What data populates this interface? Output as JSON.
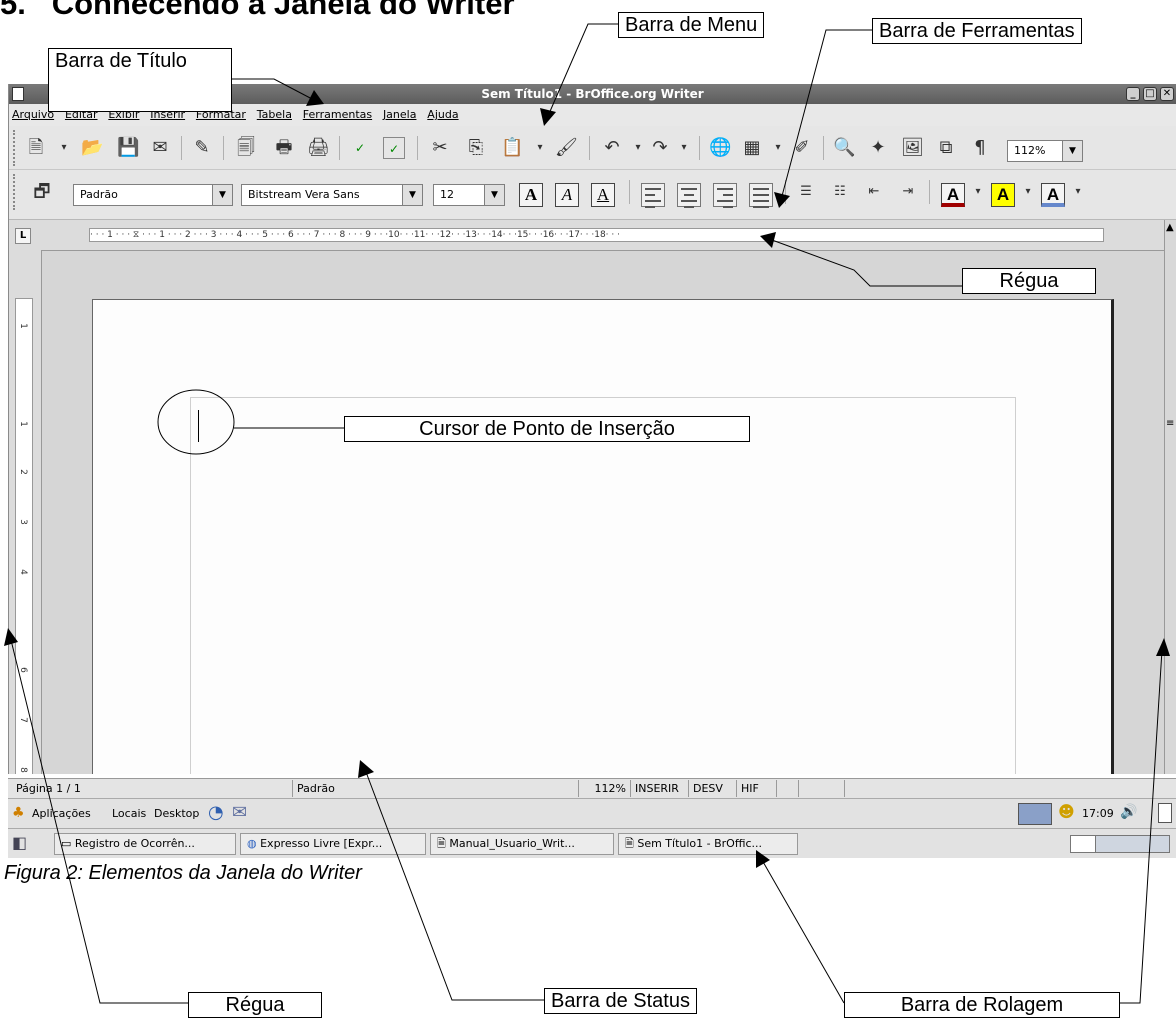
{
  "heading": "Conhecendo a Janela do Writer",
  "callouts": {
    "menu_bar": "Barra de Menu",
    "tool_bar": "Barra de Ferramentas",
    "title_bar": "Barra de Título",
    "ruler_top": "Régua",
    "insertion_cursor": "Cursor de Ponto de Inserção",
    "ruler_bottom": "Régua",
    "status_bar": "Barra de Status",
    "scroll_bar": "Barra de Rolagem"
  },
  "window": {
    "title": "Sem Título1 - BrOffice.org Writer",
    "menu": [
      "Arquivo",
      "Editar",
      "Exibir",
      "Inserir",
      "Formatar",
      "Tabela",
      "Ferramentas",
      "Janela",
      "Ajuda"
    ],
    "zoom_value": "112%",
    "style_value": "Padrão",
    "font_value": "Bitstream Vera Sans",
    "size_value": "12",
    "ruler_marks": "· · · 1 · · · ⧖ · · · 1 · · · 2 · · · 3 · · · 4 · · · 5 · · · 6 · · · 7 · · · 8 · · · 9 · · ·10· · ·11· · ·12· · ·13· · ·14· · ·15· · ·16· · ·17· · ·18· · ·",
    "status": {
      "page": "Página 1 / 1",
      "style": "Padrão",
      "zoom": "112%",
      "insert": "INSERIR",
      "selection": "DESV",
      "hyphen": "HIF"
    }
  },
  "panel": {
    "applications": "Aplicações",
    "places": "Locais",
    "desktop": "Desktop",
    "clock": "17:09"
  },
  "tasks": [
    "Registro de Ocorrên...",
    "Expresso Livre [Expr...",
    "Manual_Usuario_Writ...",
    "Sem Título1 - BrOffic..."
  ],
  "caption": "Figura 2: Elementos da Janela do Writer"
}
